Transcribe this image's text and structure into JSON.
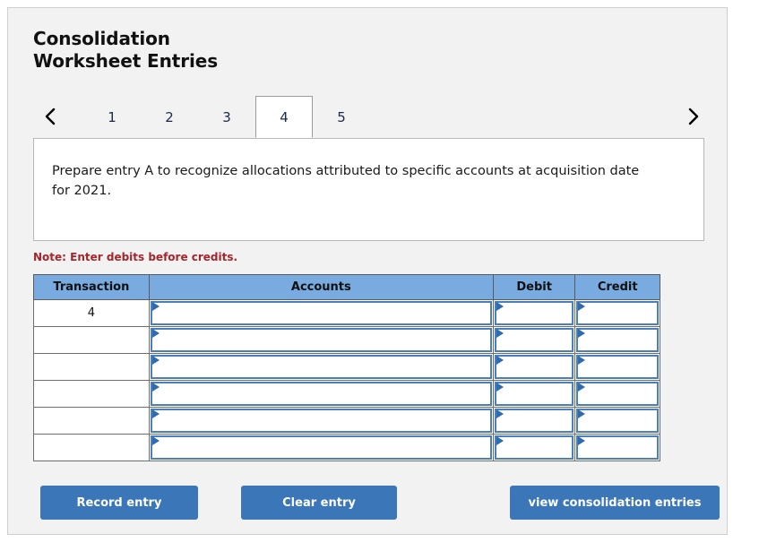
{
  "page": {
    "title_line1": "Consolidation",
    "title_line2": "Worksheet Entries"
  },
  "tabs": {
    "prev_label": "previous",
    "next_label": "next",
    "items": [
      {
        "label": "1",
        "active": false
      },
      {
        "label": "2",
        "active": false
      },
      {
        "label": "3",
        "active": false
      },
      {
        "label": "4",
        "active": true
      },
      {
        "label": "5",
        "active": false
      }
    ]
  },
  "instruction": {
    "text": "Prepare entry A to recognize allocations attributed to specific accounts at acquisition date for 2021."
  },
  "note": {
    "text": "Note: Enter debits before credits."
  },
  "table": {
    "headers": {
      "transaction": "Transaction",
      "accounts": "Accounts",
      "debit": "Debit",
      "credit": "Credit"
    },
    "rows": [
      {
        "transaction": "4",
        "accounts": "",
        "debit": "",
        "credit": ""
      },
      {
        "transaction": "",
        "accounts": "",
        "debit": "",
        "credit": ""
      },
      {
        "transaction": "",
        "accounts": "",
        "debit": "",
        "credit": ""
      },
      {
        "transaction": "",
        "accounts": "",
        "debit": "",
        "credit": ""
      },
      {
        "transaction": "",
        "accounts": "",
        "debit": "",
        "credit": ""
      },
      {
        "transaction": "",
        "accounts": "",
        "debit": "",
        "credit": ""
      }
    ]
  },
  "buttons": {
    "record": "Record entry",
    "clear": "Clear entry",
    "view": "view consolidation entries"
  },
  "colors": {
    "header_blue": "#7aabe0",
    "button_blue": "#3a76b8",
    "field_border_blue": "#4a7fbd",
    "note_red": "#a3262c",
    "card_background": "#f2f2f2"
  }
}
